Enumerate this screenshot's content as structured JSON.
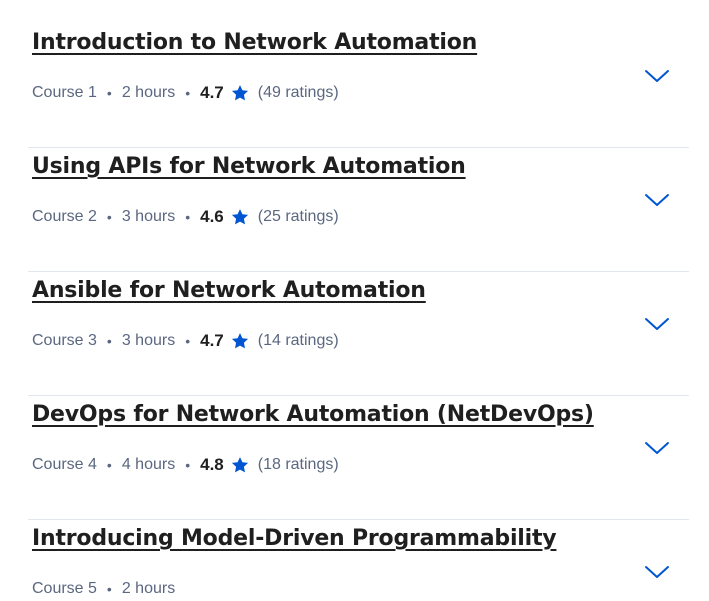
{
  "colors": {
    "title": "#1f1f1f",
    "meta": "#5b6780",
    "star": "#0056d2",
    "chevron": "#0056d2",
    "divider": "#e1e6ef"
  },
  "courses": [
    {
      "title": "Introduction to Network Automation",
      "course_label": "Course 1",
      "duration": "2 hours",
      "rating": "4.7",
      "ratings_count": "(49 ratings)"
    },
    {
      "title": "Using APIs for Network Automation",
      "course_label": "Course 2",
      "duration": "3 hours",
      "rating": "4.6",
      "ratings_count": "(25 ratings)"
    },
    {
      "title": "Ansible for Network Automation",
      "course_label": "Course 3",
      "duration": "3 hours",
      "rating": "4.7",
      "ratings_count": "(14 ratings)"
    },
    {
      "title": "DevOps for Network Automation (NetDevOps)",
      "course_label": "Course 4",
      "duration": "4 hours",
      "rating": "4.8",
      "ratings_count": "(18 ratings)"
    },
    {
      "title": "Introducing Model-Driven Programmability",
      "course_label": "Course 5",
      "duration": "2 hours"
    }
  ],
  "icons": {
    "rating": "star-icon",
    "expand": "chevron-down-icon"
  }
}
